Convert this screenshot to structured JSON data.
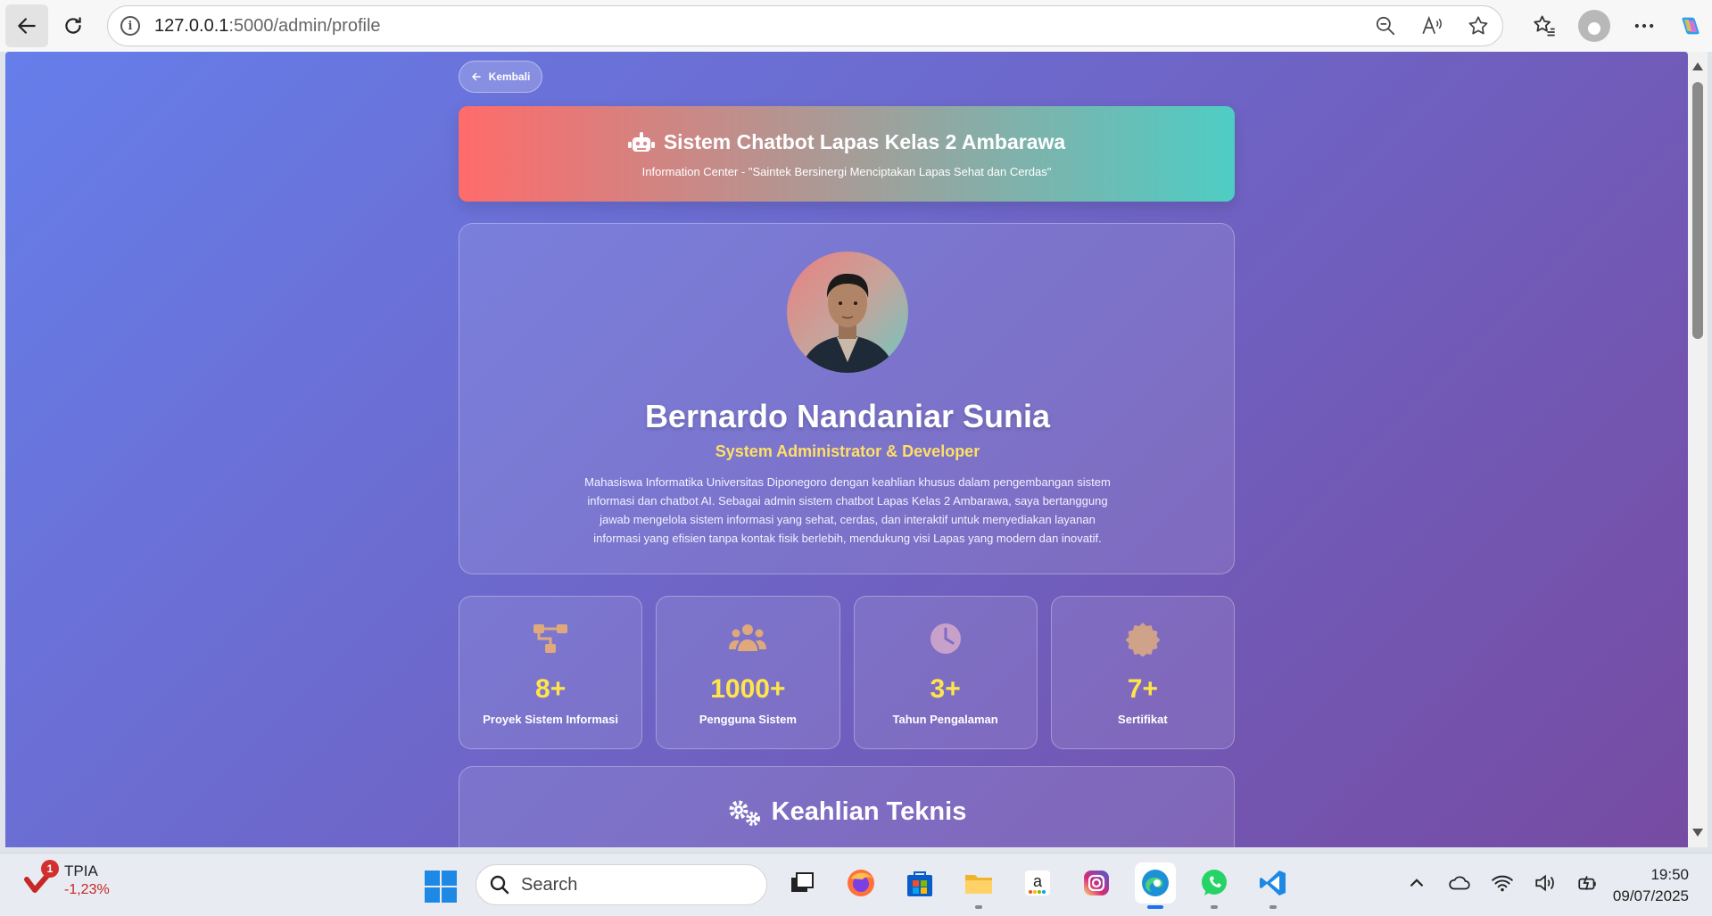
{
  "browser": {
    "url_host": "127.0.0.1",
    "url_path": ":5000/admin/profile"
  },
  "page": {
    "back_label": "Kembali",
    "header": {
      "title": "Sistem Chatbot Lapas Kelas 2 Ambarawa",
      "subtitle": "Information Center - \"Saintek Bersinergi Menciptakan Lapas Sehat dan Cerdas\""
    },
    "profile": {
      "name": "Bernardo Nandaniar Sunia",
      "role": "System Administrator & Developer",
      "bio": "Mahasiswa Informatika Universitas Diponegoro dengan keahlian khusus dalam pengembangan sistem informasi dan chatbot AI. Sebagai admin sistem chatbot Lapas Kelas 2 Ambarawa, saya bertanggung jawab mengelola sistem informasi yang sehat, cerdas, dan interaktif untuk menyediakan layanan informasi yang efisien tanpa kontak fisik berlebih, mendukung visi Lapas yang modern dan inovatif."
    },
    "stats": [
      {
        "value": "8+",
        "label": "Proyek Sistem Informasi",
        "icon": "sitemap-icon",
        "color": "#e0a97c"
      },
      {
        "value": "1000+",
        "label": "Pengguna Sistem",
        "icon": "users-icon",
        "color": "#e0a97c"
      },
      {
        "value": "3+",
        "label": "Tahun Pengalaman",
        "icon": "clock-icon",
        "color": "#c7a1c9"
      },
      {
        "value": "7+",
        "label": "Sertifikat",
        "icon": "certificate-icon",
        "color": "#cfa38a"
      }
    ],
    "skills_title": "Keahlian Teknis"
  },
  "taskbar": {
    "stock_ticker": "TPIA",
    "stock_change": "-1,23%",
    "stock_badge": "1",
    "search_placeholder": "Search",
    "time": "19:50",
    "date": "09/07/2025"
  },
  "colors": {
    "bg_gradient_start": "#667eea",
    "bg_gradient_end": "#764ba2",
    "header_gradient_start": "#ff6b6b",
    "header_gradient_end": "#4ecdc4",
    "accent_yellow": "#ffe54a"
  }
}
